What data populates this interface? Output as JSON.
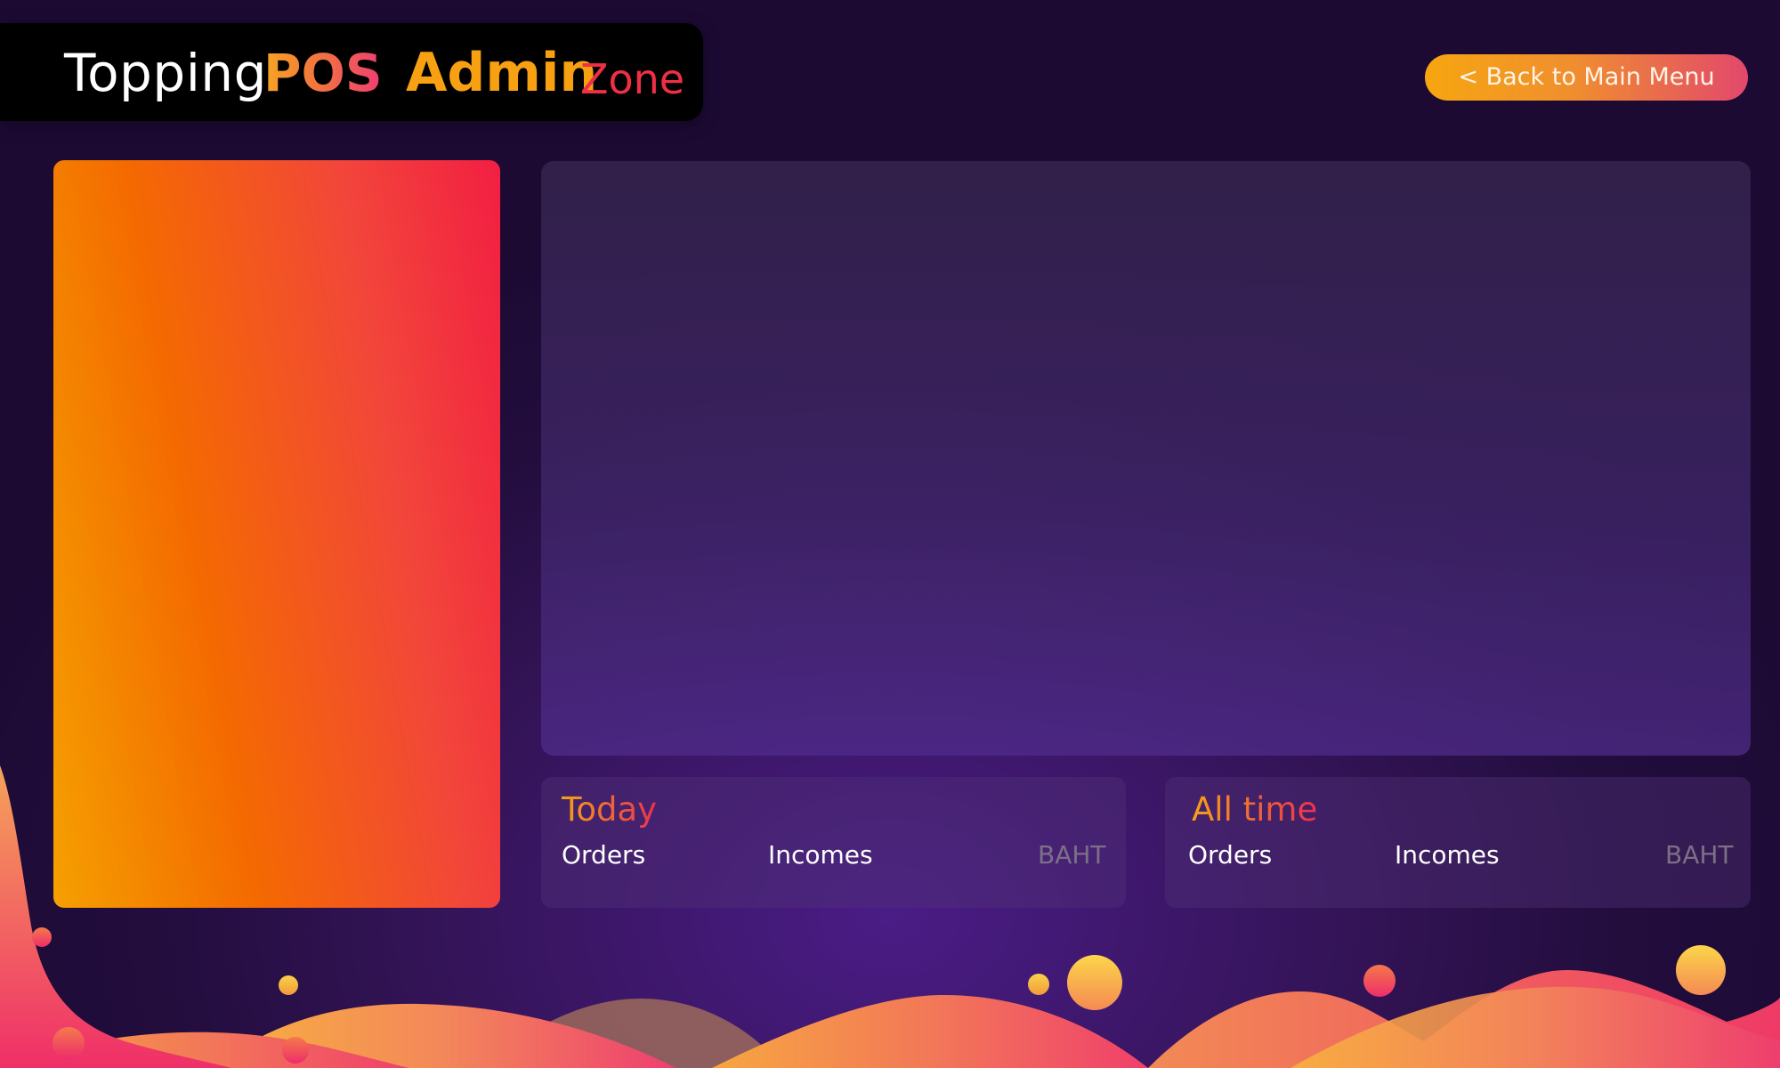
{
  "header": {
    "brand_part1": "Topping",
    "brand_part2": "POS",
    "section_part1": "Admin",
    "section_part2": "Zone",
    "back_button_label": "< Back to Main Menu"
  },
  "stats": {
    "today": {
      "title": "Today",
      "orders_label": "Orders",
      "incomes_label": "Incomes",
      "unit": "BAHT"
    },
    "all_time": {
      "title": "All time",
      "orders_label": "Orders",
      "incomes_label": "Incomes",
      "unit": "BAHT"
    }
  },
  "colors": {
    "background": "#220d3d",
    "accent_orange": "#f6a610",
    "accent_pink": "#e2486c",
    "accent_red": "#f21f42"
  }
}
